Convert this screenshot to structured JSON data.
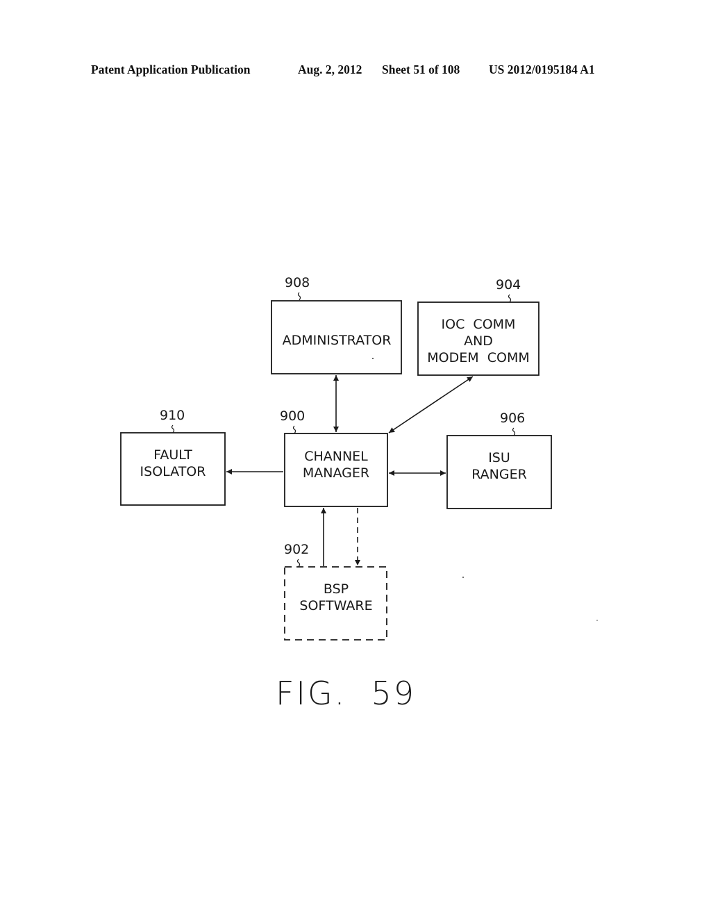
{
  "header": {
    "publication": "Patent Application Publication",
    "date": "Aug. 2, 2012",
    "sheet": "Sheet 51 of 108",
    "pub_number": "US 2012/0195184 A1"
  },
  "figure": {
    "label": "FIG.  59"
  },
  "blocks": {
    "administrator": {
      "ref": "908",
      "lines": [
        "ADMINISTRATOR"
      ]
    },
    "ioc_comm": {
      "ref": "904",
      "lines": [
        "IOC  COMM",
        "AND",
        "MODEM  COMM"
      ]
    },
    "fault_isolator": {
      "ref": "910",
      "lines": [
        "FAULT",
        "ISOLATOR"
      ]
    },
    "channel_manager": {
      "ref": "900",
      "lines": [
        "CHANNEL",
        "MANAGER"
      ]
    },
    "isu_ranger": {
      "ref": "906",
      "lines": [
        "ISU",
        "RANGER"
      ]
    },
    "bsp_software": {
      "ref": "902",
      "lines": [
        "BSP",
        "SOFTWARE"
      ],
      "dashed": true
    }
  },
  "connections": [
    {
      "from": "administrator",
      "to": "channel_manager",
      "direction": "bidirectional",
      "style": "solid"
    },
    {
      "from": "ioc_comm",
      "to": "channel_manager",
      "direction": "bidirectional",
      "style": "solid"
    },
    {
      "from": "channel_manager",
      "to": "fault_isolator",
      "direction": "forward",
      "style": "solid"
    },
    {
      "from": "channel_manager",
      "to": "isu_ranger",
      "direction": "bidirectional",
      "style": "solid"
    },
    {
      "from": "bsp_software",
      "to": "channel_manager",
      "direction": "forward",
      "style": "solid"
    },
    {
      "from": "channel_manager",
      "to": "bsp_software",
      "direction": "forward",
      "style": "dashed"
    }
  ]
}
